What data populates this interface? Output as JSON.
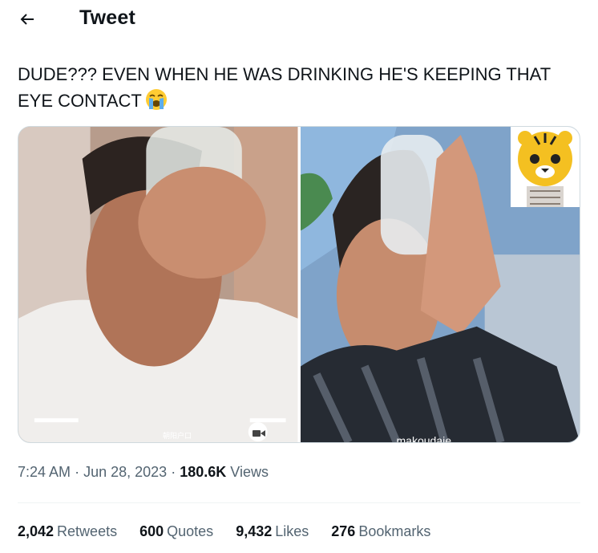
{
  "header": {
    "title": "Tweet",
    "back_icon": "arrow-left-icon"
  },
  "tweet": {
    "text": "DUDE??? EVEN WHEN HE WAS DRINKING HE'S KEEPING THAT EYE CONTACT",
    "emoji": "loudly-crying-face",
    "media": [
      {
        "description_icon": "photo-left"
      },
      {
        "description_icon": "photo-right",
        "sticker": "tiger-face-sticker",
        "caption_fragment": "makoudaie"
      }
    ],
    "left_video_badge": "video-camera-icon",
    "left_watermark": "朝阳户口"
  },
  "meta": {
    "time": "7:24 AM",
    "dot": "·",
    "date": "Jun 28, 2023",
    "views_count": "180.6K",
    "views_label": "Views"
  },
  "stats": {
    "retweets_count": "2,042",
    "retweets_label": "Retweets",
    "quotes_count": "600",
    "quotes_label": "Quotes",
    "likes_count": "9,432",
    "likes_label": "Likes",
    "bookmarks_count": "276",
    "bookmarks_label": "Bookmarks"
  },
  "colors": {
    "text_primary": "#0f1419",
    "text_secondary": "#536471",
    "divider": "#eff3f4"
  }
}
